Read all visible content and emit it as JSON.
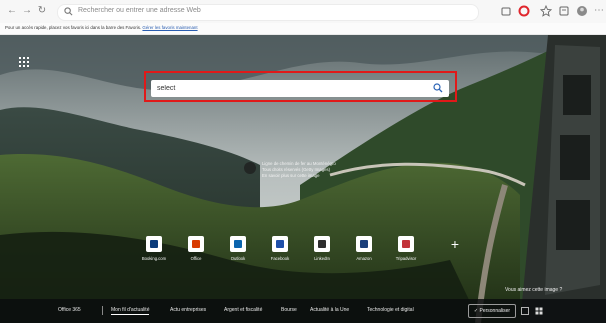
{
  "browser": {
    "address_bar_text": "Rechercher ou entrer une adresse Web",
    "favorites_bar_message": "Pour un accès rapide, placez vos favoris ici dans la barre des Favoris.",
    "favorites_bar_link": "Gérer les favoris maintenant"
  },
  "search": {
    "query": "select"
  },
  "image_info": {
    "lines": [
      "Ligne de chemin de fer au Monténégro",
      "Tous droits réservés (Getty Images)",
      "En savoir plus sur cette image"
    ]
  },
  "quick_links": [
    {
      "label": "Booking.com",
      "icon": "booking-icon",
      "color": "#0b3b7a"
    },
    {
      "label": "Office",
      "icon": "office-icon",
      "color": "#d83b01"
    },
    {
      "label": "Outlook",
      "icon": "outlook-icon",
      "color": "#0a64ad"
    },
    {
      "label": "Facebook",
      "icon": "facebook-icon",
      "color": "#1f4fa8"
    },
    {
      "label": "LinkedIn",
      "icon": "linkedin-icon",
      "color": "#2d2d2d"
    },
    {
      "label": "Amazon",
      "icon": "amazon-icon",
      "color": "#1a3f7a"
    },
    {
      "label": "Tripadvisor",
      "icon": "tripadvisor-icon",
      "color": "#c2333a"
    }
  ],
  "like_image_text": "Vous aimez cette image ?",
  "bottom_nav": {
    "office": "Office 365",
    "items": [
      "Mon fil d'actualité",
      "Actu entreprises",
      "Argent et fiscalité",
      "Bourse",
      "Actualité à la Une",
      "Technologie et digital"
    ],
    "personalize": "Personnaliser"
  },
  "colors": {
    "highlight": "#e01919",
    "favorites_link": "#2a5db0"
  }
}
